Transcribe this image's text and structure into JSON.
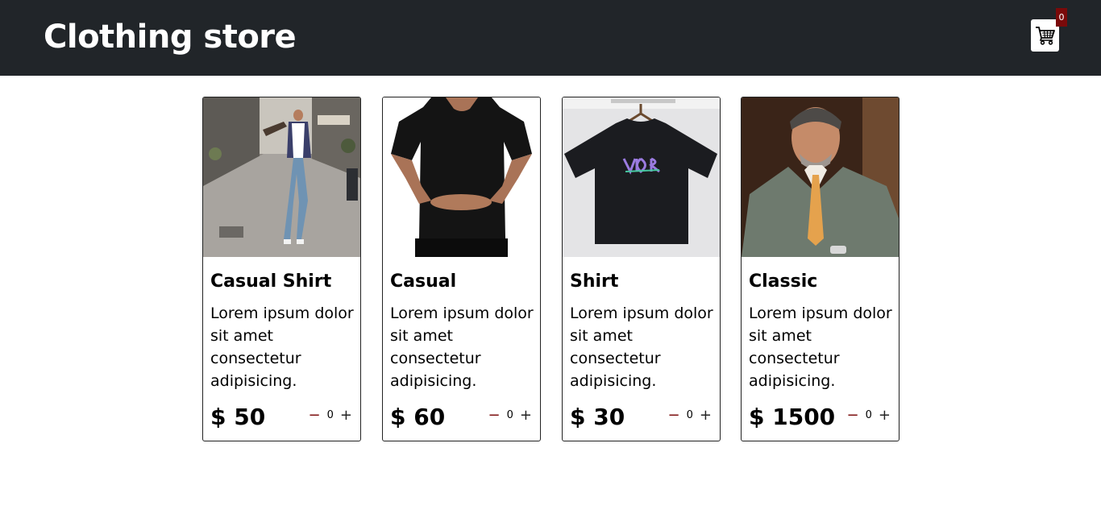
{
  "header": {
    "brand": "Clothing store",
    "cart_icon": "shopping-cart-icon",
    "cart_count": "0"
  },
  "colors": {
    "navbar": "#212529",
    "badge": "#7a0a0a"
  },
  "products": [
    {
      "title": "Casual Shirt",
      "description": "Lorem ipsum dolor sit amet consectetur adipisicing.",
      "price": "$ 50",
      "quantity": "0",
      "minus": "−",
      "plus": "+"
    },
    {
      "title": "Casual",
      "description": "Lorem ipsum dolor sit amet consectetur adipisicing.",
      "price": "$ 60",
      "quantity": "0",
      "minus": "−",
      "plus": "+"
    },
    {
      "title": "Shirt",
      "description": "Lorem ipsum dolor sit amet consectetur adipisicing.",
      "price": "$ 30",
      "quantity": "0",
      "minus": "−",
      "plus": "+"
    },
    {
      "title": "Classic",
      "description": "Lorem ipsum dolor sit amet consectetur adipisicing.",
      "price": "$ 1500",
      "quantity": "0",
      "minus": "−",
      "plus": "+"
    }
  ]
}
